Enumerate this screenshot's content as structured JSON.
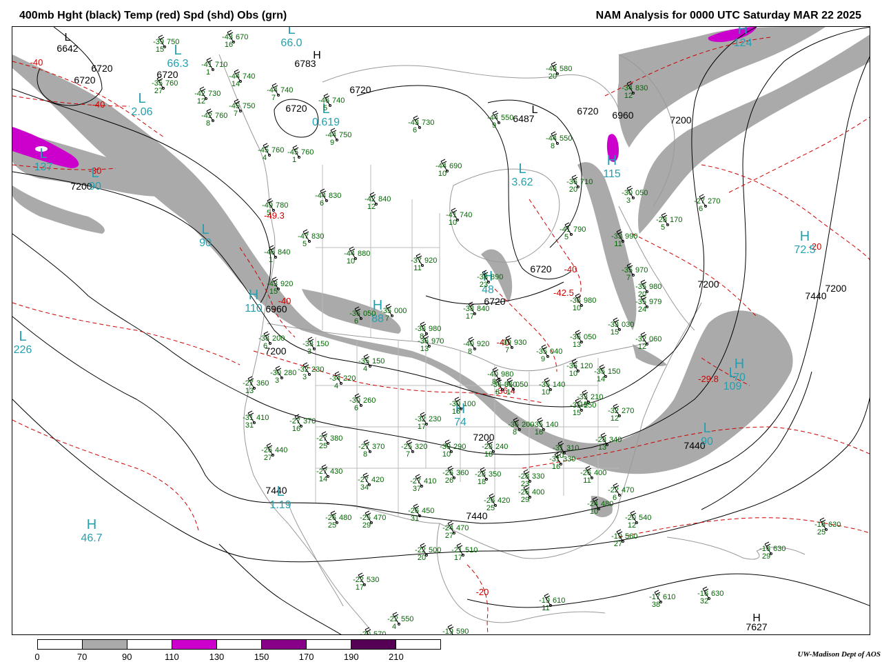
{
  "header": {
    "left_title": "400mb Hght (black) Temp (red) Spd (shd) Obs (grn)",
    "right_title": "NAM Analysis for 0000 UTC Saturday  MAR 22 2025"
  },
  "colors": {
    "height_contour": "#000000",
    "temp_contour": "#cc0000",
    "speed_70_90": "#aaaaaa",
    "speed_90_110": "#ffffff",
    "speed_110_130": "#cc00cc",
    "speed_130_150": "#ffffff",
    "speed_150_170": "#880088",
    "speed_170_190": "#ffffff",
    "speed_190_210": "#550055",
    "obs": "#006600",
    "center_label": "#22a0b0",
    "map_lines": "#999999"
  },
  "height_labels": [
    "6642",
    "6720",
    "6720",
    "6720",
    "6783",
    "6720",
    "6720",
    "6487",
    "6720",
    "6960",
    "7200",
    "7200",
    "7200",
    "6960",
    "7200",
    "6720",
    "6720",
    "7200",
    "7200",
    "7440",
    "7440",
    "7440",
    "7440",
    "7627"
  ],
  "temp_labels": [
    "-40",
    "-40",
    "-30",
    "-49.3",
    "-40",
    "-42.5",
    "-40",
    "-40",
    "-36.4",
    "-29.8",
    "-20",
    "-20"
  ],
  "centers": [
    {
      "letter": "L",
      "value": "2.06"
    },
    {
      "letter": "L",
      "value": "66.3"
    },
    {
      "letter": "L",
      "value": "66.0"
    },
    {
      "letter": "L",
      "value": "137"
    },
    {
      "letter": "L",
      "value": "90"
    },
    {
      "letter": "H",
      "value": "110"
    },
    {
      "letter": "L",
      "value": "226"
    },
    {
      "letter": "L",
      "value": "0.619"
    },
    {
      "letter": "L",
      "value": "3.62"
    },
    {
      "letter": "H",
      "value": "115"
    },
    {
      "letter": "H",
      "value": "124"
    },
    {
      "letter": "L",
      "value": "90"
    },
    {
      "letter": "H",
      "value": "72.5"
    },
    {
      "letter": "L",
      "value": "109"
    },
    {
      "letter": "L",
      "value": "90"
    },
    {
      "letter": "L",
      "value": "1.19"
    },
    {
      "letter": "H",
      "value": "46.7"
    },
    {
      "letter": "H",
      "value": "88"
    },
    {
      "letter": "H",
      "value": "48"
    },
    {
      "letter": "H",
      "value": "74"
    },
    {
      "letter": "H",
      "value": "70"
    }
  ],
  "extrema_black": [
    {
      "letter": "L"
    },
    {
      "letter": "H"
    },
    {
      "letter": "L"
    },
    {
      "letter": "H"
    }
  ],
  "observations": [
    {
      "t": "-39",
      "h": "750",
      "dd": "15"
    },
    {
      "t": "-43",
      "h": "670",
      "dd": "16"
    },
    {
      "t": "-41",
      "h": "710",
      "dd": "1"
    },
    {
      "t": "-35",
      "h": "760",
      "dd": "27"
    },
    {
      "t": "-44",
      "h": "740",
      "dd": "14"
    },
    {
      "t": "-42",
      "h": "730",
      "dd": "12"
    },
    {
      "t": "-44",
      "h": "740",
      "dd": "7"
    },
    {
      "t": "-45",
      "h": "750",
      "dd": "7"
    },
    {
      "t": "-42",
      "h": "760",
      "dd": "8"
    },
    {
      "t": "-46",
      "h": "740",
      "dd": "5"
    },
    {
      "t": "-44",
      "h": "750",
      "dd": "9"
    },
    {
      "t": "-45",
      "h": "760",
      "dd": "4"
    },
    {
      "t": "-45",
      "h": "760",
      "dd": "1"
    },
    {
      "t": "-43",
      "h": "730",
      "dd": "6"
    },
    {
      "t": "-44",
      "h": "550",
      "dd": "9"
    },
    {
      "t": "-48",
      "h": "580",
      "dd": "20"
    },
    {
      "t": "-44",
      "h": "550",
      "dd": "8"
    },
    {
      "t": "-34",
      "h": "830",
      "dd": "12"
    },
    {
      "t": "-44",
      "h": "690",
      "dd": "10"
    },
    {
      "t": "-44",
      "h": "830",
      "dd": "6"
    },
    {
      "t": "-42",
      "h": "840",
      "dd": "12"
    },
    {
      "t": "-41",
      "h": "740",
      "dd": "10"
    },
    {
      "t": "-49",
      "h": "780",
      "dd": "5"
    },
    {
      "t": "-47",
      "h": "830",
      "dd": "5"
    },
    {
      "t": "-46",
      "h": "840",
      "dd": "1"
    },
    {
      "t": "-44",
      "h": "880",
      "dd": "10"
    },
    {
      "t": "-37",
      "h": "920",
      "dd": "11"
    },
    {
      "t": "-38",
      "h": "890",
      "dd": "23"
    },
    {
      "t": "-38",
      "h": "840",
      "dd": "17"
    },
    {
      "t": "-36",
      "h": "710",
      "dd": "20"
    },
    {
      "t": "-30",
      "h": "050",
      "dd": "3"
    },
    {
      "t": "-27",
      "h": "270",
      "dd": "6"
    },
    {
      "t": "-41",
      "h": "790",
      "dd": "5"
    },
    {
      "t": "-28",
      "h": "170",
      "dd": "5"
    },
    {
      "t": "-33",
      "h": "990",
      "dd": "11"
    },
    {
      "t": "-35",
      "h": "970",
      "dd": "7"
    },
    {
      "t": "-35",
      "h": "980",
      "dd": "20"
    },
    {
      "t": "-35",
      "h": "979",
      "dd": "24"
    },
    {
      "t": "-36",
      "h": "980",
      "dd": "10"
    },
    {
      "t": "-33",
      "h": "030",
      "dd": "15"
    },
    {
      "t": "-36",
      "h": "050",
      "dd": "13"
    },
    {
      "t": "-32",
      "h": "060",
      "dd": "12"
    },
    {
      "t": "-43",
      "h": "920",
      "dd": "15"
    },
    {
      "t": "-36",
      "h": "050",
      "dd": "6"
    },
    {
      "t": "-35",
      "h": "000",
      "dd": "7"
    },
    {
      "t": "-38",
      "h": "980",
      "dd": "8"
    },
    {
      "t": "-36",
      "h": "970",
      "dd": "13"
    },
    {
      "t": "-40",
      "h": "920",
      "dd": "8"
    },
    {
      "t": "-39",
      "h": "930",
      "dd": "7"
    },
    {
      "t": "-35",
      "h": "040",
      "dd": "9"
    },
    {
      "t": "-36",
      "h": "050",
      "dd": "1"
    },
    {
      "t": "-38",
      "h": "200",
      "dd": "6"
    },
    {
      "t": "-38",
      "h": "150",
      "dd": "3"
    },
    {
      "t": "-35",
      "h": "150",
      "dd": "4"
    },
    {
      "t": "-32",
      "h": "230",
      "dd": "3"
    },
    {
      "t": "-34",
      "h": "220",
      "dd": "4"
    },
    {
      "t": "-30",
      "h": "260",
      "dd": "6"
    },
    {
      "t": "-27",
      "h": "360",
      "dd": "13"
    },
    {
      "t": "-30",
      "h": "280",
      "dd": "3"
    },
    {
      "t": "-40",
      "h": "980",
      "dd": "8"
    },
    {
      "t": "-36",
      "h": "050",
      "dd": "8"
    },
    {
      "t": "-35",
      "h": "140",
      "dd": "10"
    },
    {
      "t": "-36",
      "h": "120",
      "dd": "10"
    },
    {
      "t": "-35",
      "h": "150",
      "dd": "14"
    },
    {
      "t": "-33",
      "h": "210",
      "dd": "15"
    },
    {
      "t": "-31",
      "h": "250",
      "dd": "15"
    },
    {
      "t": "-32",
      "h": "270",
      "dd": "12"
    },
    {
      "t": "-30",
      "h": "100",
      "dd": "16"
    },
    {
      "t": "-32",
      "h": "230",
      "dd": "17"
    },
    {
      "t": "-35",
      "h": "140",
      "dd": "16"
    },
    {
      "t": "-36",
      "h": "200",
      "dd": "8"
    },
    {
      "t": "-31",
      "h": "410",
      "dd": "31"
    },
    {
      "t": "-27",
      "h": "370",
      "dd": "16"
    },
    {
      "t": "-27",
      "h": "380",
      "dd": "25"
    },
    {
      "t": "-27",
      "h": "370",
      "dd": "8"
    },
    {
      "t": "-25",
      "h": "320",
      "dd": "7"
    },
    {
      "t": "-30",
      "h": "290",
      "dd": "10"
    },
    {
      "t": "-28",
      "h": "240",
      "dd": "18"
    },
    {
      "t": "-31",
      "h": "310",
      "dd": "10"
    },
    {
      "t": "-31",
      "h": "330",
      "dd": "16"
    },
    {
      "t": "-28",
      "h": "340",
      "dd": "13"
    },
    {
      "t": "-26",
      "h": "440",
      "dd": "27"
    },
    {
      "t": "-27",
      "h": "430",
      "dd": "14"
    },
    {
      "t": "-27",
      "h": "420",
      "dd": "34"
    },
    {
      "t": "-27",
      "h": "410",
      "dd": "37"
    },
    {
      "t": "-26",
      "h": "360",
      "dd": "26"
    },
    {
      "t": "-28",
      "h": "350",
      "dd": "18"
    },
    {
      "t": "-28",
      "h": "330",
      "dd": "23"
    },
    {
      "t": "-26",
      "h": "400",
      "dd": "11"
    },
    {
      "t": "-26",
      "h": "420",
      "dd": "25"
    },
    {
      "t": "-26",
      "h": "400",
      "dd": "29"
    },
    {
      "t": "-22",
      "h": "470",
      "dd": "6"
    },
    {
      "t": "-24",
      "h": "480",
      "dd": "10"
    },
    {
      "t": "-26",
      "h": "480",
      "dd": "25"
    },
    {
      "t": "-25",
      "h": "470",
      "dd": "29"
    },
    {
      "t": "-26",
      "h": "450",
      "dd": "31"
    },
    {
      "t": "-24",
      "h": "470",
      "dd": "27"
    },
    {
      "t": "-20",
      "h": "540",
      "dd": "12"
    },
    {
      "t": "-19",
      "h": "560",
      "dd": "27"
    },
    {
      "t": "-22",
      "h": "500",
      "dd": "20"
    },
    {
      "t": "-21",
      "h": "510",
      "dd": "17"
    },
    {
      "t": "-22",
      "h": "530",
      "dd": "17"
    },
    {
      "t": "-16",
      "h": "630",
      "dd": "25"
    },
    {
      "t": "-16",
      "h": "630",
      "dd": "29"
    },
    {
      "t": "-17",
      "h": "610",
      "dd": "38"
    },
    {
      "t": "-16",
      "h": "630",
      "dd": "32"
    },
    {
      "t": "-19",
      "h": "610",
      "dd": "11"
    },
    {
      "t": "-22",
      "h": "550",
      "dd": "4"
    },
    {
      "t": "-20",
      "h": "570",
      "dd": ""
    },
    {
      "t": "-19",
      "h": "590",
      "dd": ""
    }
  ],
  "scale": {
    "tick_labels": [
      "0",
      "70",
      "90",
      "110",
      "130",
      "150",
      "170",
      "190",
      "210"
    ],
    "segment_colors": [
      "#ffffff",
      "#aaaaaa",
      "#ffffff",
      "#cc00cc",
      "#ffffff",
      "#880088",
      "#ffffff",
      "#550055",
      "#ffffff"
    ]
  },
  "credit": "UW-Madison  Dept of AOS"
}
